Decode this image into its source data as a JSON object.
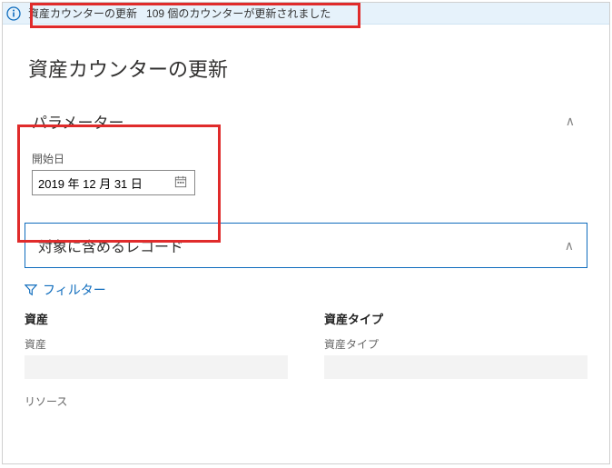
{
  "notification": {
    "title": "資産カウンターの更新",
    "message": "109 個のカウンターが更新されました"
  },
  "page": {
    "title": "資産カウンターの更新"
  },
  "params": {
    "header": "パラメーター",
    "start_date_label": "開始日",
    "start_date_value": "2019 年 12 月 31 日"
  },
  "records": {
    "header": "対象に含めるレコード",
    "filter_label": "フィルター",
    "columns": {
      "asset_header": "資産",
      "asset_label": "資産",
      "asset_type_header": "資産タイプ",
      "asset_type_label": "資産タイプ",
      "resource_label": "リソース"
    }
  },
  "chevron": "∧"
}
